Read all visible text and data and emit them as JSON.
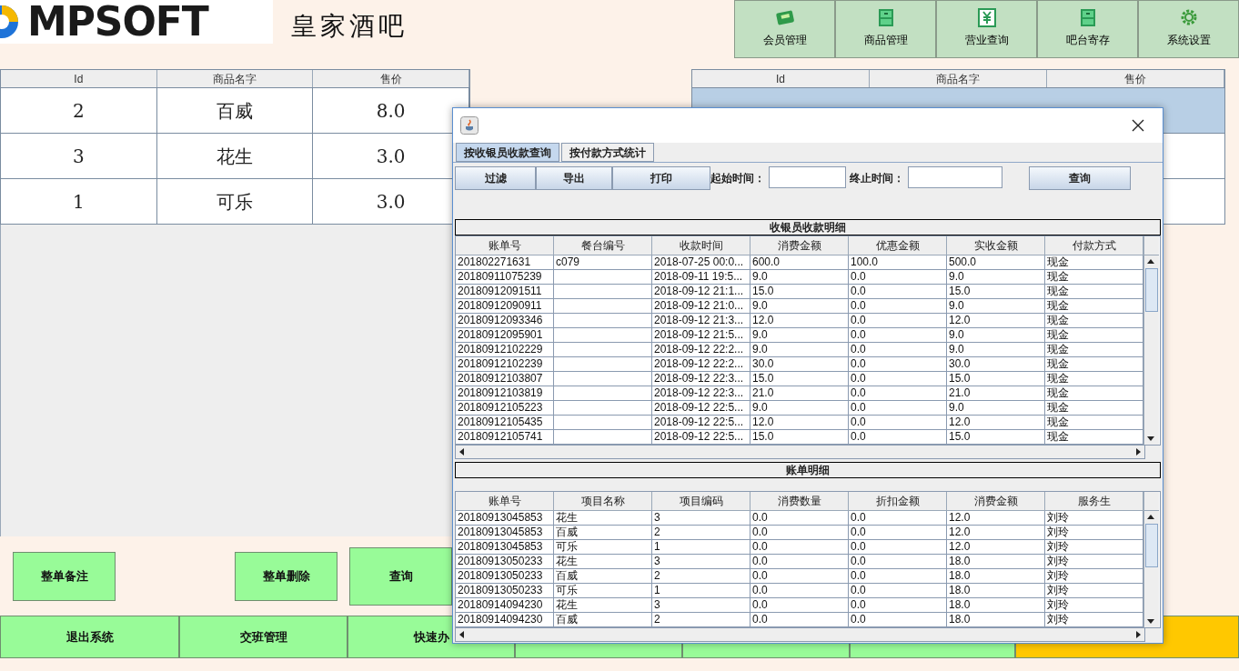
{
  "header": {
    "logo": "MPSOFT",
    "title": "皇家酒吧"
  },
  "nav": [
    {
      "label": "会员管理",
      "kind": "vip"
    },
    {
      "label": "商品管理",
      "kind": "cabinet"
    },
    {
      "label": "营业查询",
      "kind": "yen"
    },
    {
      "label": "吧台寄存",
      "kind": "cabinet"
    },
    {
      "label": "系统设置",
      "kind": "gear"
    }
  ],
  "product_table": {
    "columns": [
      "Id",
      "商品名字",
      "售价"
    ],
    "rows": [
      [
        "2",
        "百威",
        "8.0"
      ],
      [
        "3",
        "花生",
        "3.0"
      ],
      [
        "1",
        "可乐",
        "3.0"
      ]
    ]
  },
  "order_table": {
    "columns": [
      "Id",
      "商品名字",
      "售价"
    ],
    "rows": [
      {
        "selected": true
      },
      {
        "selected": false
      },
      {
        "selected": false
      }
    ]
  },
  "actions": [
    {
      "label": "整单备注"
    },
    {
      "label": "整单删除"
    },
    {
      "label": "查询"
    }
  ],
  "bottom_bar": [
    {
      "label": "退出系统",
      "color": "#98fb98"
    },
    {
      "label": "交班管理",
      "color": "#98fb98"
    },
    {
      "label": "快速办",
      "color": "#98fb98"
    },
    {
      "color": "#98fb98"
    },
    {
      "color": "#98fb98"
    },
    {
      "color": "#98fb98"
    },
    {
      "color": "#ffc800"
    }
  ],
  "dialog": {
    "tabs": [
      {
        "label": "按收银员收款查询",
        "selected": true
      },
      {
        "label": "按付款方式统计",
        "selected": false
      }
    ],
    "toolbar": [
      "过滤",
      "导出",
      "打印"
    ],
    "start_label": "起始时间：",
    "end_label": "终止时间：",
    "query_button": "查询",
    "sections": [
      {
        "title": "收银员收款明细",
        "columns": [
          "账单号",
          "餐台编号",
          "收款时间",
          "消费金额",
          "优惠金额",
          "实收金额",
          "付款方式"
        ],
        "rows": [
          [
            "201802271631",
            "c079",
            "2018-07-25 00:0...",
            "600.0",
            "100.0",
            "500.0",
            "现金"
          ],
          [
            "20180911075239",
            "",
            "2018-09-11 19:5...",
            "9.0",
            "0.0",
            "9.0",
            "现金"
          ],
          [
            "20180912091511",
            "",
            "2018-09-12 21:1...",
            "15.0",
            "0.0",
            "15.0",
            "现金"
          ],
          [
            "20180912090911",
            "",
            "2018-09-12 21:0...",
            "9.0",
            "0.0",
            "9.0",
            "现金"
          ],
          [
            "20180912093346",
            "",
            "2018-09-12 21:3...",
            "12.0",
            "0.0",
            "12.0",
            "现金"
          ],
          [
            "20180912095901",
            "",
            "2018-09-12 21:5...",
            "9.0",
            "0.0",
            "9.0",
            "现金"
          ],
          [
            "20180912102229",
            "",
            "2018-09-12 22:2...",
            "9.0",
            "0.0",
            "9.0",
            "现金"
          ],
          [
            "20180912102239",
            "",
            "2018-09-12 22:2...",
            "30.0",
            "0.0",
            "30.0",
            "现金"
          ],
          [
            "20180912103807",
            "",
            "2018-09-12 22:3...",
            "15.0",
            "0.0",
            "15.0",
            "现金"
          ],
          [
            "20180912103819",
            "",
            "2018-09-12 22:3...",
            "21.0",
            "0.0",
            "21.0",
            "现金"
          ],
          [
            "20180912105223",
            "",
            "2018-09-12 22:5...",
            "9.0",
            "0.0",
            "9.0",
            "现金"
          ],
          [
            "20180912105435",
            "",
            "2018-09-12 22:5...",
            "12.0",
            "0.0",
            "12.0",
            "现金"
          ],
          [
            "20180912105741",
            "",
            "2018-09-12 22:5...",
            "15.0",
            "0.0",
            "15.0",
            "现金"
          ]
        ]
      },
      {
        "title": "账单明细",
        "columns": [
          "账单号",
          "项目名称",
          "项目编码",
          "消费数量",
          "折扣金额",
          "消费金额",
          "服务生"
        ],
        "rows": [
          [
            "20180913045853",
            "花生",
            "3",
            "0.0",
            "0.0",
            "12.0",
            "刘玲"
          ],
          [
            "20180913045853",
            "百威",
            "2",
            "0.0",
            "0.0",
            "12.0",
            "刘玲"
          ],
          [
            "20180913045853",
            "可乐",
            "1",
            "0.0",
            "0.0",
            "12.0",
            "刘玲"
          ],
          [
            "20180913050233",
            "花生",
            "3",
            "0.0",
            "0.0",
            "18.0",
            "刘玲"
          ],
          [
            "20180913050233",
            "百威",
            "2",
            "0.0",
            "0.0",
            "18.0",
            "刘玲"
          ],
          [
            "20180913050233",
            "可乐",
            "1",
            "0.0",
            "0.0",
            "18.0",
            "刘玲"
          ],
          [
            "20180914094230",
            "花生",
            "3",
            "0.0",
            "0.0",
            "18.0",
            "刘玲"
          ],
          [
            "20180914094230",
            "百威",
            "2",
            "0.0",
            "0.0",
            "18.0",
            "刘玲"
          ]
        ]
      }
    ]
  }
}
